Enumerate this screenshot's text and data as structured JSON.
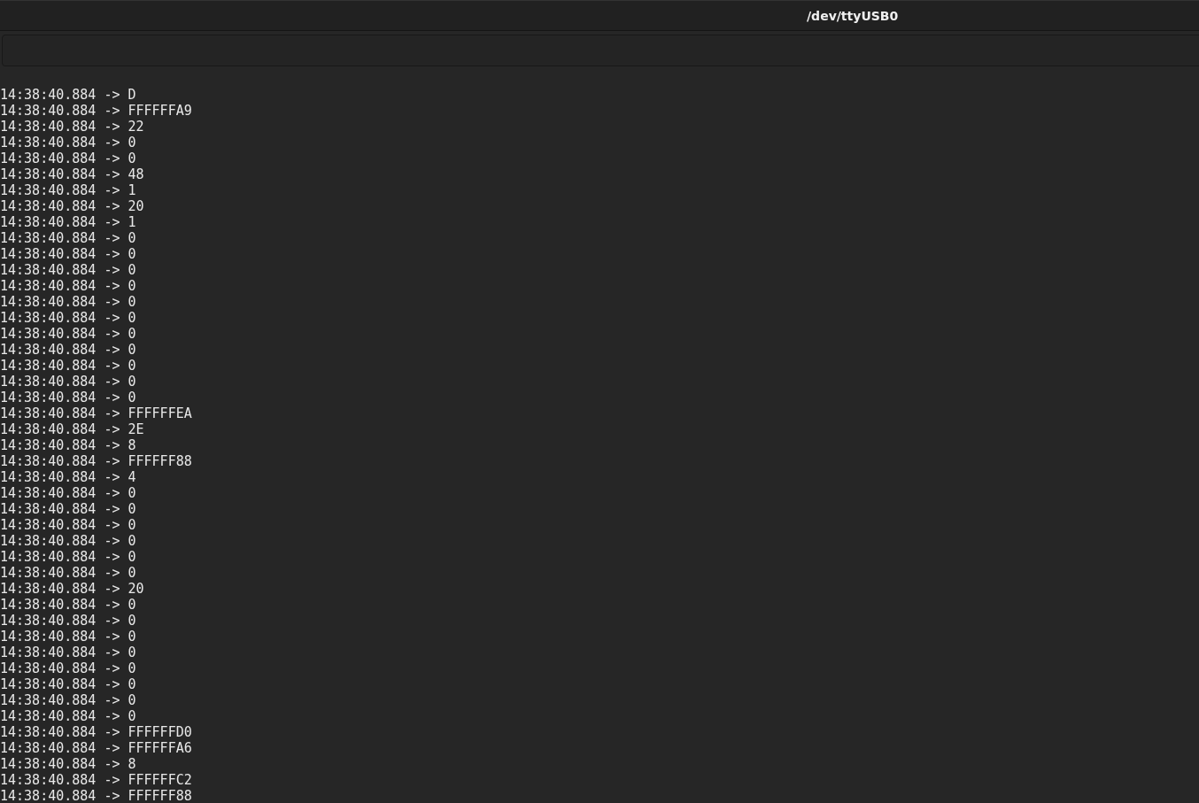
{
  "window": {
    "title": "/dev/ttyUSB0"
  },
  "log": [
    "14:38:40.884 -> D",
    "14:38:40.884 -> FFFFFFA9",
    "14:38:40.884 -> 22",
    "14:38:40.884 -> 0",
    "14:38:40.884 -> 0",
    "14:38:40.884 -> 48",
    "14:38:40.884 -> 1",
    "14:38:40.884 -> 20",
    "14:38:40.884 -> 1",
    "14:38:40.884 -> 0",
    "14:38:40.884 -> 0",
    "14:38:40.884 -> 0",
    "14:38:40.884 -> 0",
    "14:38:40.884 -> 0",
    "14:38:40.884 -> 0",
    "14:38:40.884 -> 0",
    "14:38:40.884 -> 0",
    "14:38:40.884 -> 0",
    "14:38:40.884 -> 0",
    "14:38:40.884 -> 0",
    "14:38:40.884 -> FFFFFFEA",
    "14:38:40.884 -> 2E",
    "14:38:40.884 -> 8",
    "14:38:40.884 -> FFFFFF88",
    "14:38:40.884 -> 4",
    "14:38:40.884 -> 0",
    "14:38:40.884 -> 0",
    "14:38:40.884 -> 0",
    "14:38:40.884 -> 0",
    "14:38:40.884 -> 0",
    "14:38:40.884 -> 0",
    "14:38:40.884 -> 20",
    "14:38:40.884 -> 0",
    "14:38:40.884 -> 0",
    "14:38:40.884 -> 0",
    "14:38:40.884 -> 0",
    "14:38:40.884 -> 0",
    "14:38:40.884 -> 0",
    "14:38:40.884 -> 0",
    "14:38:40.884 -> 0",
    "14:38:40.884 -> FFFFFFD0",
    "14:38:40.884 -> FFFFFFA6",
    "14:38:40.884 -> 8",
    "14:38:40.884 -> FFFFFFC2",
    "14:38:40.884 -> FFFFFF88"
  ]
}
